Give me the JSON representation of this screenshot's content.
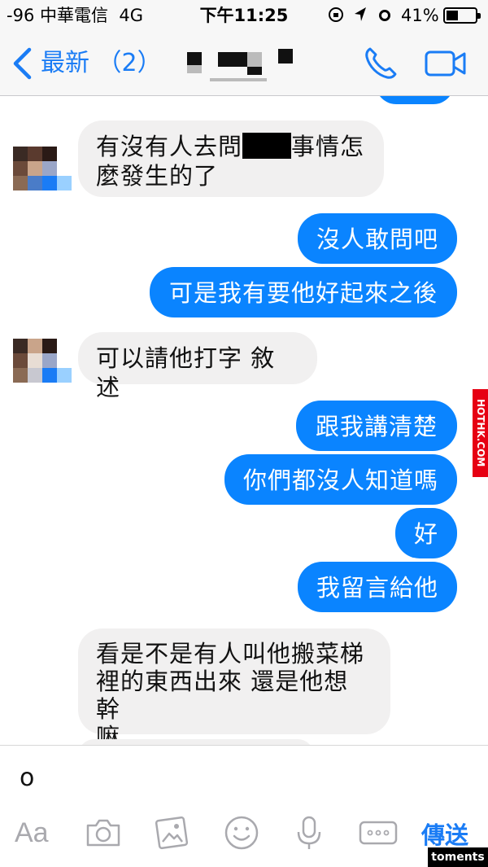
{
  "status_bar": {
    "signal": "-96 中華電信",
    "network": "4G",
    "time": "下午11:25",
    "battery": "41%",
    "battery_level": 0.41
  },
  "nav": {
    "back_label": "最新 （2）",
    "accent_color": "#1a7cf5"
  },
  "messages": [
    {
      "dir": "in",
      "text_before": "有沒有人去問",
      "text_after": "事情怎",
      "line2": "麼發生的了"
    },
    {
      "dir": "out",
      "text": "沒人敢問吧"
    },
    {
      "dir": "out",
      "text": "可是我有要他好起來之後"
    },
    {
      "dir": "in",
      "text": "可以請他打字 敘述"
    },
    {
      "dir": "out",
      "text": "跟我講清楚"
    },
    {
      "dir": "out",
      "text": "你們都沒人知道嗎"
    },
    {
      "dir": "out",
      "text": "好"
    },
    {
      "dir": "out",
      "text": "我留言給他"
    },
    {
      "dir": "in",
      "line1": "看是不是有人叫他搬菜梯",
      "line2": "裡的東西出來 還是他想幹",
      "line3": "嘛"
    }
  ],
  "input": {
    "value": "o",
    "send_label": "傳送"
  },
  "toolbar": {
    "aa_label": "Aa",
    "icons": [
      "camera-icon",
      "photo-icon",
      "emoji-icon",
      "microphone-icon",
      "more-icon"
    ]
  },
  "watermarks": {
    "side": "HOTHK.COM",
    "bottom": "toments"
  },
  "colors": {
    "outgoing_bubble": "#0a84ff",
    "incoming_bubble": "#f1f0f0"
  }
}
